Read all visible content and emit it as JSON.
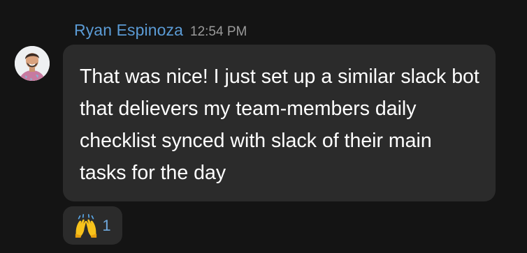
{
  "message": {
    "author": "Ryan Espinoza",
    "timestamp": "12:54 PM",
    "text": "That was nice! I just set up a similar slack bot that delievers my team-members daily checklist synced with slack of their main tasks for the day"
  },
  "reaction": {
    "emoji_icon": "raising-hands-emoji",
    "count": "1"
  },
  "colors": {
    "background": "#141414",
    "bubble": "#2b2b2b",
    "author_name": "#5b9bd5",
    "timestamp": "#9a9a9a",
    "message_text": "#ffffff",
    "reaction_count": "#6fa8dc"
  }
}
